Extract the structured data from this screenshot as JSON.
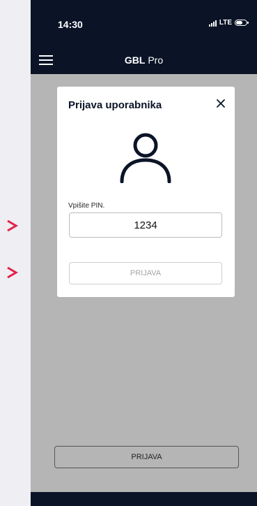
{
  "status_bar": {
    "time": "14:30",
    "network": "LTE"
  },
  "app_bar": {
    "title_bold": "GBL",
    "title_rest": " Pro",
    "menu_icon": "hamburger-icon"
  },
  "dialog": {
    "title": "Prijava uporabnika",
    "close_icon": "close-icon",
    "avatar_icon": "user-icon",
    "pin_label": "Vpišite PIN.",
    "pin_value": "1234",
    "login_label": "PRIJAVA"
  },
  "page": {
    "bottom_button_label": "PRIJAVA"
  },
  "annotations": {
    "arrow_icon": "chevron-right-icon",
    "arrow_color": "#e4204a"
  },
  "colors": {
    "header": "#0b1427",
    "overlay": "#b5b5b5",
    "background": "#eeeef3"
  }
}
